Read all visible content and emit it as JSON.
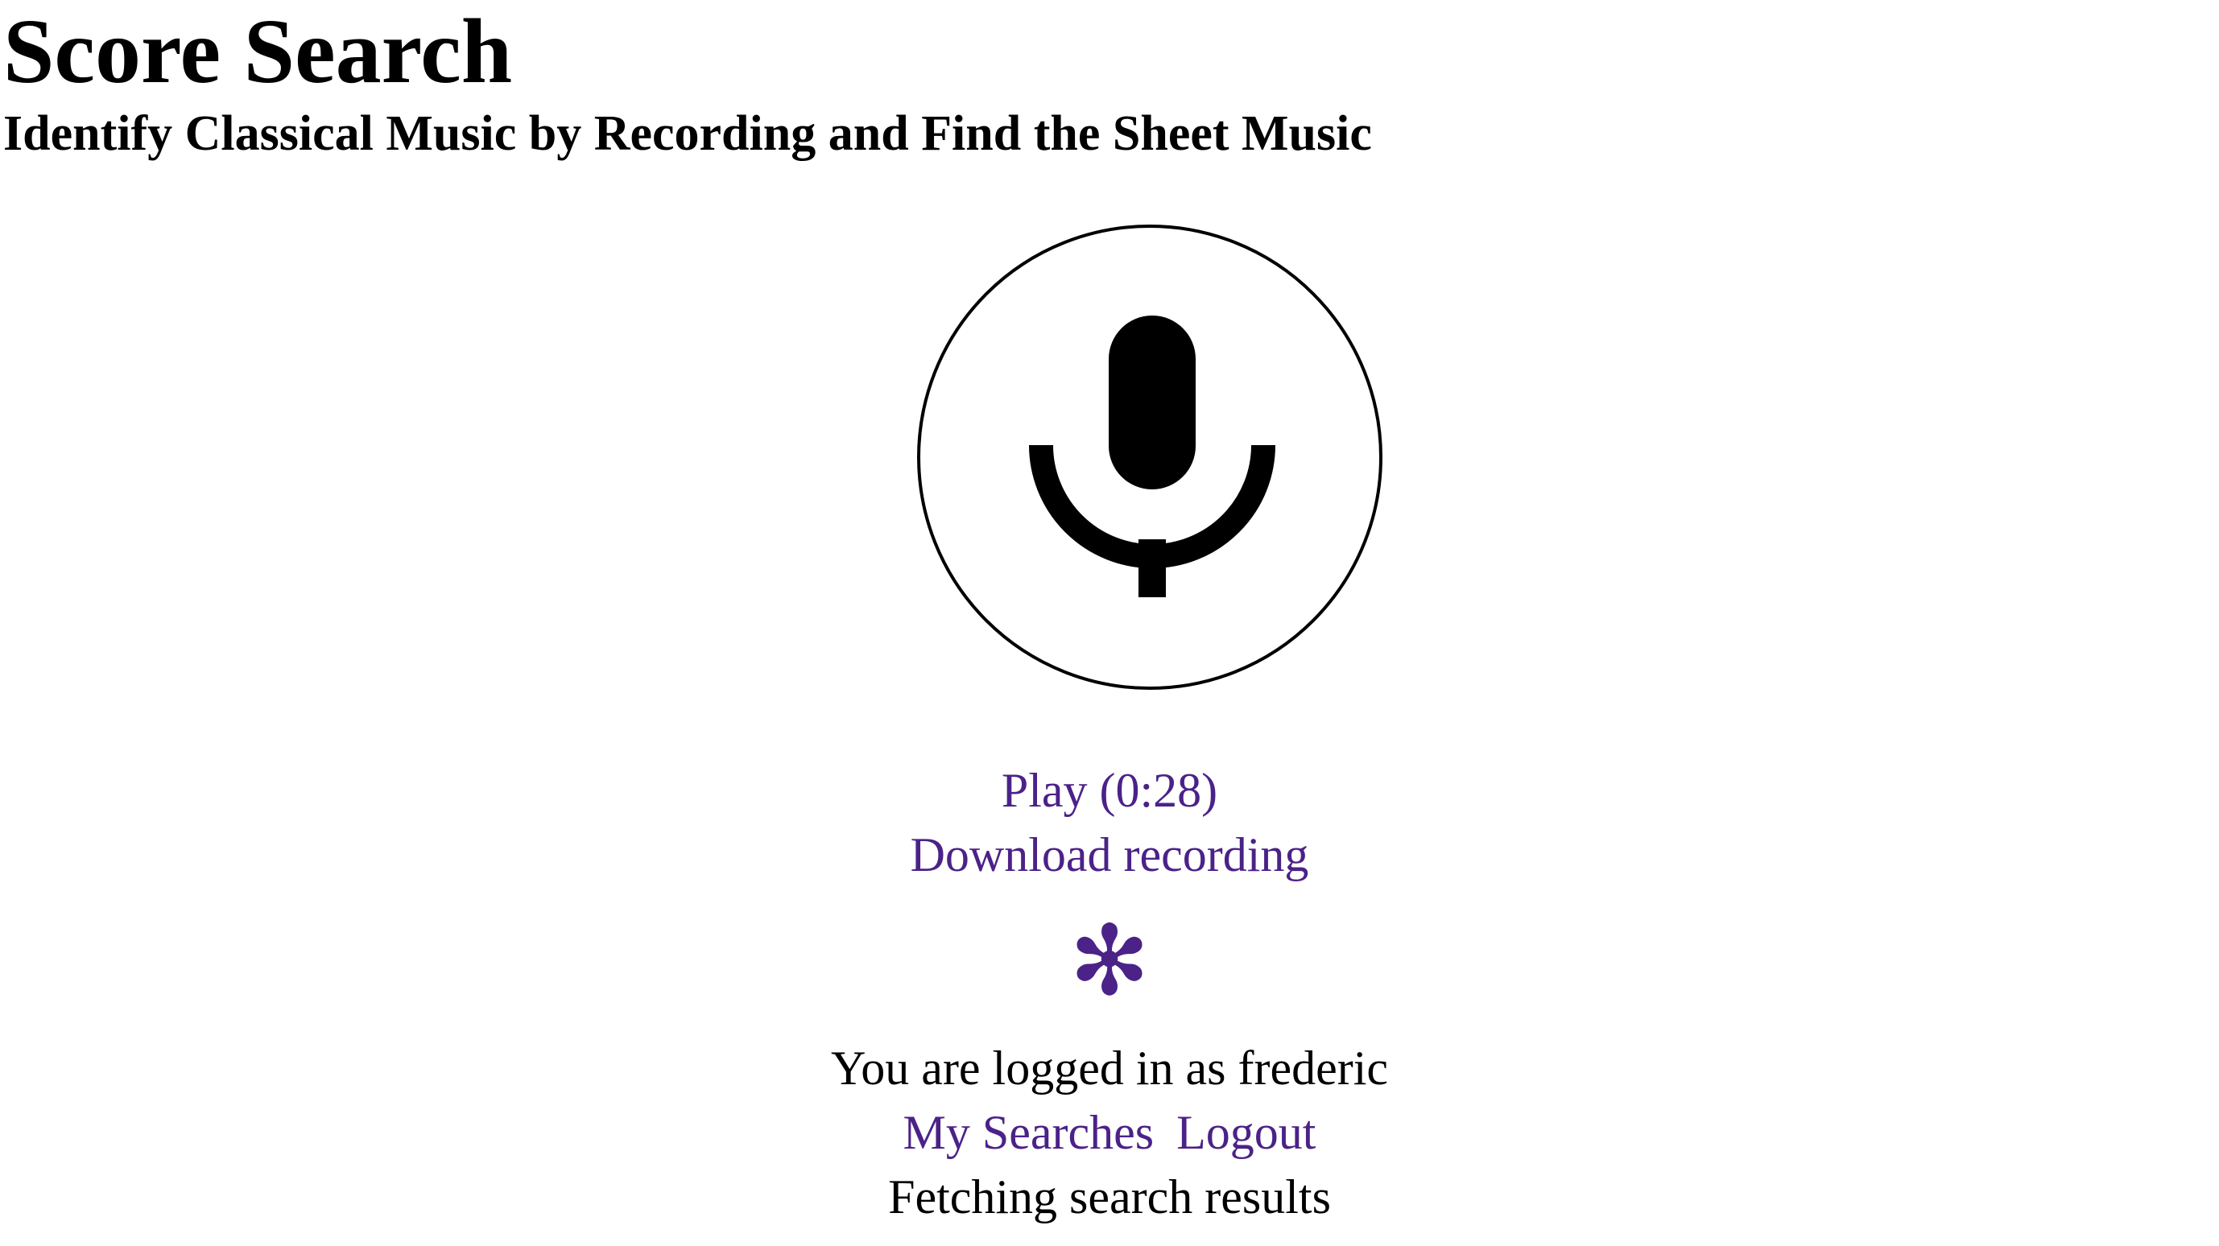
{
  "header": {
    "title": "Score Search",
    "subtitle": "Identify Classical Music by Recording and Find the Sheet Music"
  },
  "recorder": {
    "icon": "microphone-icon",
    "play_label": "Play (0:28)",
    "download_label": "Download recording"
  },
  "spinner": {
    "glyph": "✻",
    "color": "#4b2288"
  },
  "account": {
    "status_text": "You are logged in as frederic",
    "my_searches_label": "My Searches",
    "logout_label": "Logout"
  },
  "status": {
    "message": "Fetching search results"
  },
  "colors": {
    "link": "#4b2288",
    "text": "#000000",
    "background": "#ffffff"
  }
}
